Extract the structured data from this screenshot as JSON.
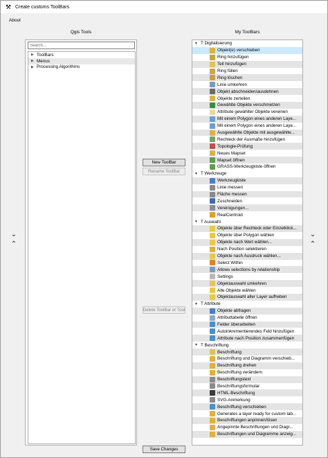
{
  "window": {
    "title": "Create customs ToolBars",
    "icon": "tools-icon"
  },
  "menubar": {
    "about": "About"
  },
  "left": {
    "label": "Qgis Tools",
    "search_placeholder": "Search...",
    "items": [
      "ToolBars",
      "Menus",
      "Processing Algorithms"
    ]
  },
  "right": {
    "label": "My ToolBars",
    "groups": [
      {
        "name": "T Digitalisierung",
        "items": [
          {
            "label": "Objekt(e) verschieben",
            "icon": "move-feature-icon",
            "color": "#d9b24a"
          },
          {
            "label": "Ring hinzufügen",
            "icon": "add-ring-icon",
            "color": "#c9a43d"
          },
          {
            "label": "Teil hinzufügen",
            "icon": "add-part-icon",
            "color": "#e2c25a"
          },
          {
            "label": "Ring füllen",
            "icon": "fill-ring-icon",
            "color": "#d0a63a"
          },
          {
            "label": "Ring löschen",
            "icon": "delete-ring-icon",
            "color": "#c8a045"
          },
          {
            "label": "Linie umkehren",
            "icon": "reverse-line-icon",
            "color": "#7a9bc0"
          },
          {
            "label": "Objekt abschneiden/ausdehnen",
            "icon": "trim-extend-icon",
            "color": "#6a6a6a"
          },
          {
            "label": "Objekte zerteilen",
            "icon": "split-features-icon",
            "color": "#d9b24a"
          },
          {
            "label": "Gewählte Objekte verschmelzen",
            "icon": "merge-features-icon",
            "color": "#3d8b3d"
          },
          {
            "label": "Attribute gewählter Objekte vereinen",
            "icon": "merge-attributes-icon",
            "color": "#e8d9a0"
          },
          {
            "label": "Mit einem Polygon eines anderen Laye...",
            "icon": "reshape-polygon-icon",
            "color": "#6d9fd1"
          },
          {
            "label": "Mit einem Polygon eines anderen Laye...",
            "icon": "reshape-polygon-icon",
            "color": "#6d9fd1"
          },
          {
            "label": "Ausgewählte Objekte mit ausgewählte...",
            "icon": "selected-features-icon",
            "color": "#e0b040"
          },
          {
            "label": "Rechteck der Ausmaße hinzufügen",
            "icon": "extent-rectangle-icon",
            "color": "#7aa06a"
          },
          {
            "label": "Topologie-Prüfung",
            "icon": "topology-checker-icon",
            "color": "#c05050"
          },
          {
            "label": "Neues Mapset",
            "icon": "grass-new-mapset-icon",
            "color": "#d9b24a"
          },
          {
            "label": "Mapset öffnen",
            "icon": "grass-open-mapset-icon",
            "color": "#5f9e4f"
          },
          {
            "label": "GRASS-Werkzeugkiste öffnen",
            "icon": "grass-tools-icon",
            "color": "#5f9e4f"
          }
        ]
      },
      {
        "name": "T Werkzeuge",
        "items": [
          {
            "label": "Werkzeugkiste",
            "icon": "toolbox-icon",
            "color": "#4a7fc1"
          },
          {
            "label": "Linie messen",
            "icon": "measure-line-icon",
            "color": "#8a8a8a"
          },
          {
            "label": "Fläche messen",
            "icon": "measure-area-icon",
            "color": "#8a8a8a"
          },
          {
            "label": "Zuschneiden",
            "icon": "clip-icon",
            "color": "#3d6fb0"
          },
          {
            "label": "Vereinigungen...",
            "icon": "union-icon",
            "color": "#8a8aa0"
          },
          {
            "label": "RealCentroid",
            "icon": "real-centroid-icon",
            "color": "#e0a020"
          }
        ]
      },
      {
        "name": "T Auswahl",
        "items": [
          {
            "label": "Objekte über Rechteck oder Einzelklick...",
            "icon": "select-rectangle-icon",
            "color": "#e8c84a"
          },
          {
            "label": "Objekte über Polygon wählen",
            "icon": "select-polygon-icon",
            "color": "#e8c84a"
          },
          {
            "label": "Objekte nach Wert wählen...",
            "icon": "select-by-value-icon",
            "color": "#e8c84a"
          },
          {
            "label": "Nach Position selektieren",
            "icon": "select-by-location-icon",
            "color": "#e0b040"
          },
          {
            "label": "Objekte nach Ausdruck wählen...",
            "icon": "select-by-expression-icon",
            "color": "#e8c84a"
          },
          {
            "label": "Select Within",
            "icon": "select-within-icon",
            "color": "#e08030"
          },
          {
            "label": "Allows selections by relationship",
            "icon": "select-relationship-icon",
            "color": "#7a9bc0"
          },
          {
            "label": "Settings",
            "icon": "settings-icon",
            "color": "#b8b8b8"
          },
          {
            "label": "Objektauswahl umkehren",
            "icon": "invert-selection-icon",
            "color": "#e8c84a"
          },
          {
            "label": "Alle Objekte wählen",
            "icon": "select-all-icon",
            "color": "#e8c84a"
          },
          {
            "label": "Objektauswahl aller Layer aufheben",
            "icon": "deselect-all-icon",
            "color": "#e8c84a"
          }
        ]
      },
      {
        "name": "T Attribute",
        "items": [
          {
            "label": "Objekte abfragen",
            "icon": "identify-icon",
            "color": "#4a7fc1"
          },
          {
            "label": "Attributtabelle öffnen",
            "icon": "attribute-table-icon",
            "color": "#8aa8c8"
          },
          {
            "label": "Felder überarbeiten",
            "icon": "field-calculator-icon",
            "color": "#4a90c8"
          },
          {
            "label": "Autoinkrementierendes Feld hinzufügen",
            "icon": "autoincrement-icon",
            "color": "#4a90c8"
          },
          {
            "label": "Attribute nach Position zusammenfügen",
            "icon": "join-by-location-icon",
            "color": "#4a90c8"
          }
        ]
      },
      {
        "name": "T Beschriftung",
        "items": [
          {
            "label": "Beschriftung",
            "icon": "label-icon",
            "color": "#e0c060"
          },
          {
            "label": "Beschriftung und Diagramm verschieb...",
            "icon": "move-label-icon",
            "color": "#e0b040"
          },
          {
            "label": "Beschriftung drehen",
            "icon": "rotate-label-icon",
            "color": "#e0b040"
          },
          {
            "label": "Beschriftung verändern",
            "icon": "change-label-icon",
            "color": "#e0b040"
          },
          {
            "label": "Beschriftungstext",
            "icon": "text-annotation-icon",
            "color": "#8a8a8a"
          },
          {
            "label": "Beschriftungsformular",
            "icon": "form-annotation-icon",
            "color": "#8a8a8a"
          },
          {
            "label": "HTML-Beschriftung",
            "icon": "html-annotation-icon",
            "color": "#3a3a3a"
          },
          {
            "label": "SVG-Anmerkung",
            "icon": "svg-annotation-icon",
            "color": "#8a8a8a"
          },
          {
            "label": "Beschriftung verschieben",
            "icon": "move-annotation-icon",
            "color": "#4a90c8"
          },
          {
            "label": "Generates a layer ready for custom lab...",
            "icon": "custom-labels-icon",
            "color": "#e0b040"
          },
          {
            "label": "Beschriftungen anpinnen/lösen",
            "icon": "pin-labels-icon",
            "color": "#e0b040"
          },
          {
            "label": "Angepinnte Beschriftungen und Diagr...",
            "icon": "pinned-labels-icon",
            "color": "#e0b040"
          },
          {
            "label": "Beschriftungen und Diagramme anzeig...",
            "icon": "show-labels-icon",
            "color": "#e0b040"
          }
        ]
      }
    ]
  },
  "buttons": {
    "new_toolbar": "New ToolBar",
    "rename_toolbar": "Rename ToolBar",
    "delete_toolbar": "Delete ToolBar or Tool",
    "save_changes": "Save Changes"
  }
}
